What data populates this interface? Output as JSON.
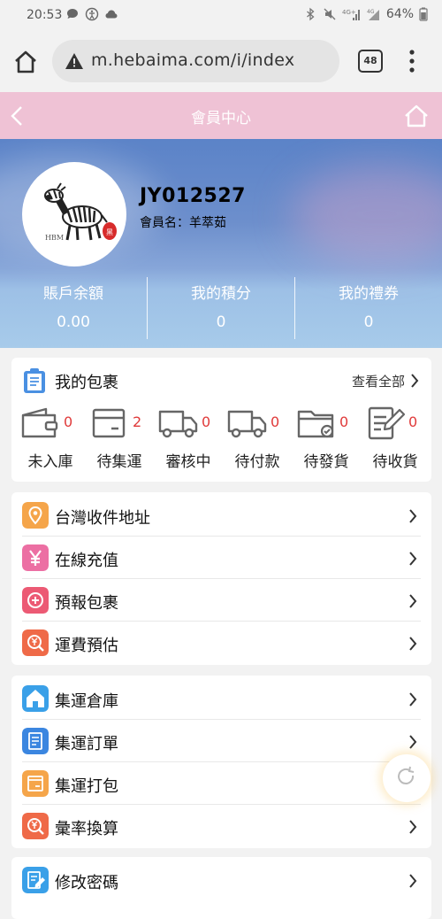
{
  "status_bar": {
    "time": "20:53",
    "battery": "64%"
  },
  "browser": {
    "url": "m.hebaima.com/i/index",
    "tab_count": "48"
  },
  "header": {
    "title": "會員中心"
  },
  "profile": {
    "user_id": "JY012527",
    "member_name": "會員名：羊萃茹",
    "avatar_logo_text": "HBM",
    "stats": [
      {
        "label": "賬戶余額",
        "value": "0.00"
      },
      {
        "label": "我的積分",
        "value": "0"
      },
      {
        "label": "我的禮券",
        "value": "0"
      }
    ]
  },
  "packages": {
    "title": "我的包裹",
    "view_all": "查看全部",
    "items": [
      {
        "label": "未入庫",
        "count": "0",
        "icon": "wallet-icon"
      },
      {
        "label": "待集運",
        "count": "2",
        "icon": "box-icon"
      },
      {
        "label": "審核中",
        "count": "0",
        "icon": "truck-icon"
      },
      {
        "label": "待付款",
        "count": "0",
        "icon": "truck-icon"
      },
      {
        "label": "待發貨",
        "count": "0",
        "icon": "folder-check-icon"
      },
      {
        "label": "待收貨",
        "count": "0",
        "icon": "edit-doc-icon"
      }
    ]
  },
  "menu_group_1": [
    {
      "label": "台灣收件地址",
      "icon": "location-icon",
      "color": "#f5a54a"
    },
    {
      "label": "在線充值",
      "icon": "yen-icon",
      "color": "#ec6fa3"
    },
    {
      "label": "預報包裹",
      "icon": "plus-icon",
      "color": "#ec5a74"
    },
    {
      "label": "運費預估",
      "icon": "yen-search-icon",
      "color": "#ef6a48"
    }
  ],
  "menu_group_2": [
    {
      "label": "集運倉庫",
      "icon": "warehouse-icon",
      "color": "#3aa0e8"
    },
    {
      "label": "集運訂單",
      "icon": "order-doc-icon",
      "color": "#3b86e0"
    },
    {
      "label": "集運打包",
      "icon": "package-icon",
      "color": "#f5a54a"
    },
    {
      "label": "彙率換算",
      "icon": "exchange-icon",
      "color": "#ef6a48"
    }
  ],
  "menu_group_3": [
    {
      "label": "修改密碼",
      "icon": "edit-password-icon",
      "color": "#3aa0e8"
    }
  ]
}
